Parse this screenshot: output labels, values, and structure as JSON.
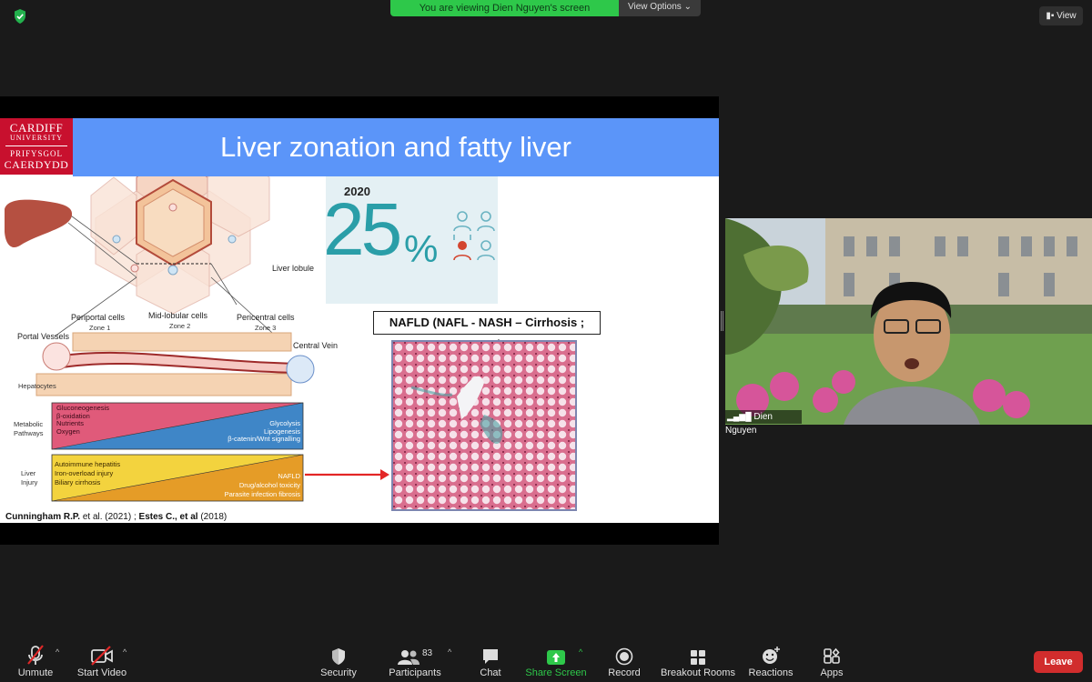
{
  "top_bar": {
    "viewing_text": "You are viewing Dien Nguyen's screen",
    "view_options_label": "View Options",
    "view_label": "View"
  },
  "slide": {
    "logo": {
      "line1": "CARDIFF",
      "line2": "UNIVERSITY",
      "line3": "PRIFYSGOL",
      "line4": "CAERDYDD"
    },
    "title": "Liver zonation and fatty liver",
    "stat_year": "2020",
    "stat_value": "25",
    "stat_unit": "%",
    "nafld_label": "NAFLD (NAFL - NASH – Cirrhosis ; HCC)",
    "diagram": {
      "liver_lobule": "Liver lobule",
      "periportal": "Periportal cells",
      "zone1": "Zone 1",
      "midlobular": "Mid-lobular cells",
      "zone2": "Zone 2",
      "pericentral": "Pericentral cells",
      "zone3": "Zone 3",
      "portal_vessels": "Portal Vessels",
      "central_vein": "Central Vein",
      "hepatocytes": "Hepatocytes",
      "metabolic": "Metabolic",
      "pathways": "Pathways",
      "liver": "Liver",
      "injury": "Injury",
      "pathways_left": [
        "Gluconeogenesis",
        "β-oxidation",
        "Nutrients",
        "Oxygen"
      ],
      "pathways_right": [
        "Glycolysis",
        "Lipogenesis",
        "β-catenin/Wnt signalling"
      ],
      "injury_left": [
        "Autoimmune hepatitis",
        "Iron-overload injury",
        "Biliary cirrhosis"
      ],
      "injury_right": [
        "NAFLD",
        "Drug/alcohol toxicity",
        "Parasite infection fibrosis"
      ]
    },
    "citation": {
      "a_bold": "Cunningham R.P.",
      "a_rest": " et al. (2021) ; ",
      "b_bold": "Estes C., et al",
      "b_rest": " (2018)"
    }
  },
  "video": {
    "participant_name": "Dien Nguyen"
  },
  "toolbar": {
    "unmute": "Unmute",
    "start_video": "Start Video",
    "security": "Security",
    "participants": "Participants",
    "participants_count": "83",
    "chat": "Chat",
    "share_screen": "Share Screen",
    "record": "Record",
    "breakout_rooms": "Breakout Rooms",
    "reactions": "Reactions",
    "apps": "Apps",
    "leave": "Leave"
  },
  "colors": {
    "share_green": "#2ec84a",
    "leave_red": "#d12d2d",
    "title_blue": "#5b95f9",
    "stat_teal": "#2a9ea8",
    "cardiff_red": "#c8102e"
  }
}
